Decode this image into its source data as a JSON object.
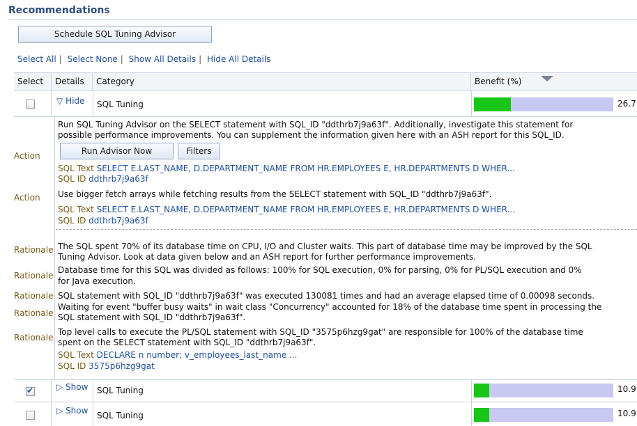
{
  "header": {
    "title": "Recommendations"
  },
  "toolbar": {
    "schedule_label": "Schedule SQL Tuning Advisor"
  },
  "selection_links": [
    "Select All",
    "Select None",
    "Show All Details",
    "Hide All Details"
  ],
  "table": {
    "columns": {
      "select": "Select",
      "details": "Details",
      "category": "Category",
      "benefit": "Benefit (%)"
    },
    "sorted_by": "Benefit (%)",
    "sort_order": "descending",
    "rows": [
      {
        "checked": false,
        "toggle_icon": "▽",
        "toggle_label": "Hide",
        "category": "SQL Tuning",
        "benefit": "26.7",
        "benefit_fraction": 0.267
      },
      {
        "checked": true,
        "toggle_icon": "▷",
        "toggle_label": "Show",
        "category": "SQL Tuning",
        "benefit": "10.9",
        "benefit_fraction": 0.109
      },
      {
        "checked": false,
        "toggle_icon": "▷",
        "toggle_label": "Show",
        "category": "SQL Tuning",
        "benefit": "10.9",
        "benefit_fraction": 0.109
      }
    ]
  },
  "details": {
    "action_label": "Action",
    "rationale_label": "Rationale",
    "sql_text_key": "SQL Text",
    "sql_id_key": "SQL ID",
    "actions": [
      {
        "line1": "Run SQL Tuning Advisor on the SELECT statement with SQL_ID \"ddthrb7j9a63f\". Additionally, investigate this statement for",
        "line2": "possible performance improvements. You can supplement the information given here with an ASH report for this SQL_ID.",
        "run_button": "Run Advisor Now",
        "filters_button": "Filters",
        "sql_text": "SELECT E.LAST_NAME, D.DEPARTMENT_NAME FROM HR.EMPLOYEES E, HR.DEPARTMENTS D WHER...",
        "sql_id": "ddthrb7j9a63f"
      },
      {
        "line1": "Use bigger fetch arrays while fetching results from the SELECT statement with SQL_ID \"ddthrb7j9a63f\".",
        "sql_text": "SELECT E.LAST_NAME, D.DEPARTMENT_NAME FROM HR.EMPLOYEES E, HR.DEPARTMENTS D WHER...",
        "sql_id": "ddthrb7j9a63f"
      }
    ],
    "rationales": [
      {
        "line1": "The SQL spent 70% of its database time on CPU, I/O and Cluster waits. This part of database time may be improved by the SQL",
        "line2": "Tuning Advisor. Look at data given below and an ASH report for further performance improvements."
      },
      {
        "line1": "Database time for this SQL was divided as follows: 100% for SQL execution, 0% for parsing, 0% for PL/SQL execution and 0%",
        "line2": "for Java execution."
      },
      {
        "line1": "SQL statement with SQL_ID \"ddthrb7j9a63f\" was executed 130081 times and had an average elapsed time of 0.00098 seconds."
      },
      {
        "line1": "Waiting for event \"buffer busy waits\" in wait class \"Concurrency\" accounted for 18% of the database time spent in processing the",
        "line2": "SQL statement with SQL_ID \"ddthrb7j9a63f\"."
      },
      {
        "line1": "Top level calls to execute the PL/SQL statement with SQL_ID \"3575p6hzg9gat\" are responsible for 100% of the database time",
        "line2": "spent on the SELECT statement with SQL_ID \"ddthrb7j9a63f\".",
        "sql_text": "DECLARE n number; v_employees_last_name ...",
        "sql_id": "3575p6hzg9gat"
      }
    ]
  },
  "colors": {
    "bar_fill": "#17c617",
    "bar_track": "#c8c8f1",
    "link": "#1d4f99",
    "header_title": "#2f4e80",
    "label_brown": "#7a5a17"
  }
}
